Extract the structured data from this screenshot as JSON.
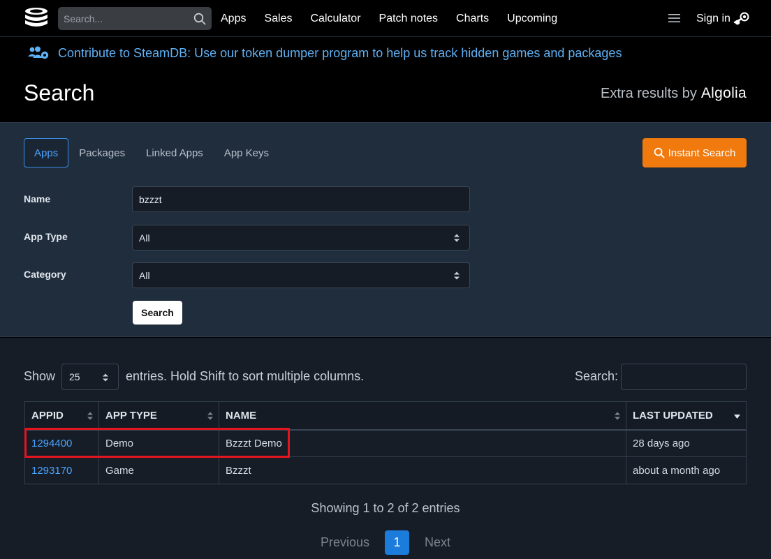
{
  "nav": {
    "search_placeholder": "Search...",
    "links": [
      "Apps",
      "Sales",
      "Calculator",
      "Patch notes",
      "Charts",
      "Upcoming"
    ],
    "signin_label": "Sign in"
  },
  "banner": {
    "text": "Contribute to SteamDB: Use our token dumper program to help us track hidden games and packages"
  },
  "header": {
    "title": "Search",
    "algolia_prefix": "Extra results by",
    "algolia_brand": "Algolia"
  },
  "form": {
    "tabs": [
      "Apps",
      "Packages",
      "Linked Apps",
      "App Keys"
    ],
    "active_tab": "Apps",
    "instant_search_label": "Instant Search",
    "name_label": "Name",
    "name_value": "bzzzt",
    "app_type_label": "App Type",
    "app_type_value": "All",
    "category_label": "Category",
    "category_value": "All",
    "search_button_label": "Search"
  },
  "results": {
    "show_label": "Show",
    "entries_value": "25",
    "entries_text": "entries. Hold Shift to sort multiple columns.",
    "search_label": "Search:",
    "columns": [
      "APPID",
      "APP TYPE",
      "NAME",
      "LAST UPDATED"
    ],
    "rows": [
      {
        "appid": "1294400",
        "type": "Demo",
        "name": "Bzzzt Demo",
        "updated": "28 days ago"
      },
      {
        "appid": "1293170",
        "type": "Game",
        "name": "Bzzzt",
        "updated": "about a month ago"
      }
    ],
    "showing_text": "Showing 1 to 2 of 2 entries",
    "pager": {
      "previous": "Previous",
      "current": "1",
      "next": "Next"
    }
  },
  "colors": {
    "accent_blue": "#4aa3ff",
    "instant_orange": "#f07a0d",
    "highlight_red": "#e3151f",
    "panel_bg": "#202d3d"
  }
}
